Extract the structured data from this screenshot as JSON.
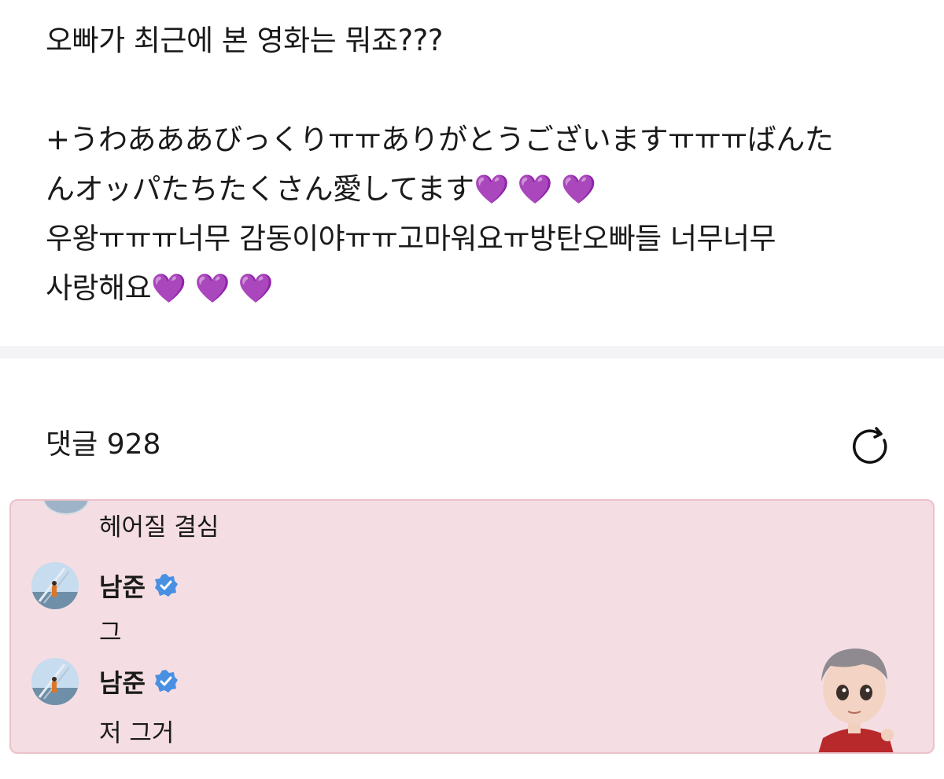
{
  "post": {
    "lines": [
      "오빠가 최근에 본 영화는 뭐죠???",
      "",
      "+うわあああびっくりㅠㅠありがとうございますㅠㅠㅠばんた",
      "んオッパたちたくさん愛してます",
      "우왕ㅠㅠㅠ너무 감동이야ㅠㅠ고마워요ㅠ방탄오빠들 너무너무",
      "사랑해요"
    ],
    "hearts": "💜 💜 💜"
  },
  "comments": {
    "label": "댓글",
    "count": "928",
    "partial_comment": "헤어질 결심",
    "items": [
      {
        "author": "남준",
        "text": "그"
      },
      {
        "author": "남준",
        "text": "저 그거"
      }
    ]
  },
  "icons": {
    "refresh": "refresh-icon",
    "verified": "verified-badge-icon",
    "heart": "purple-heart-emoji"
  },
  "colors": {
    "highlight_bg": "#f5dee3",
    "verified": "#4a90e2",
    "heart": "#9b4ee3"
  }
}
